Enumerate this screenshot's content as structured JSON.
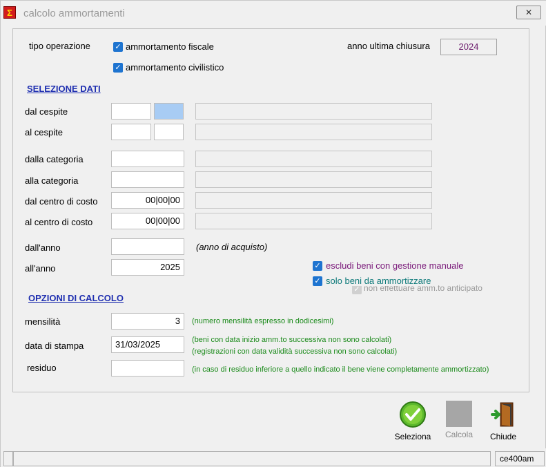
{
  "window": {
    "title": "calcolo ammortamenti",
    "close_label": "✕"
  },
  "header": {
    "tipo_operazione_label": "tipo operazione",
    "fiscale_label": "ammortamento fiscale",
    "fiscale_checked": true,
    "civilistico_label": "ammortamento civilistico",
    "civilistico_checked": true,
    "anno_chiusura_label": "anno ultima chiusura",
    "anno_chiusura_value": "2024"
  },
  "selezione": {
    "title": "SELEZIONE DATI",
    "dal_cespite_label": "dal cespite",
    "al_cespite_label": "al cespite",
    "dalla_categoria_label": "dalla categoria",
    "alla_categoria_label": "alla categoria",
    "dal_centro_label": "dal centro di costo",
    "dal_centro_value": "00|00|00",
    "al_centro_label": "al centro di costo",
    "al_centro_value": "00|00|00",
    "dall_anno_label": "dall'anno",
    "dall_anno_value": "",
    "anno_hint": "(anno di acquisto)",
    "all_anno_label": "all'anno",
    "all_anno_value": "2025",
    "escludi_label": "escludi beni con gestione manuale",
    "escludi_checked": true,
    "solo_label": "solo beni da ammortizzare",
    "solo_checked": true,
    "anticipato_label": "non effettuare amm.to anticipato"
  },
  "opzioni": {
    "title": "OPZIONI DI CALCOLO",
    "mensilita_label": "mensilità",
    "mensilita_value": "3",
    "mensilita_hint": "(numero mensilità espresso in dodicesimi)",
    "data_stampa_label": "data di stampa",
    "data_stampa_value": "31/03/2025",
    "data_hint_1": "(beni con data inizio amm.to successiva non sono calcolati)",
    "data_hint_2": "(registrazioni con data validità successiva non sono calcolati)",
    "residuo_label": "residuo",
    "residuo_value": "",
    "residuo_hint": "(in caso di residuo inferiore a quello indicato il bene viene completamente ammortizzato)"
  },
  "toolbar": {
    "seleziona_label": "Seleziona",
    "calcola_label": "Calcola",
    "chiude_label": "Chiude"
  },
  "status": {
    "program": "ce400am"
  },
  "colors": {
    "accent": "#1e74d0",
    "section": "#1f2fb0",
    "hint": "#1a8a1a"
  }
}
